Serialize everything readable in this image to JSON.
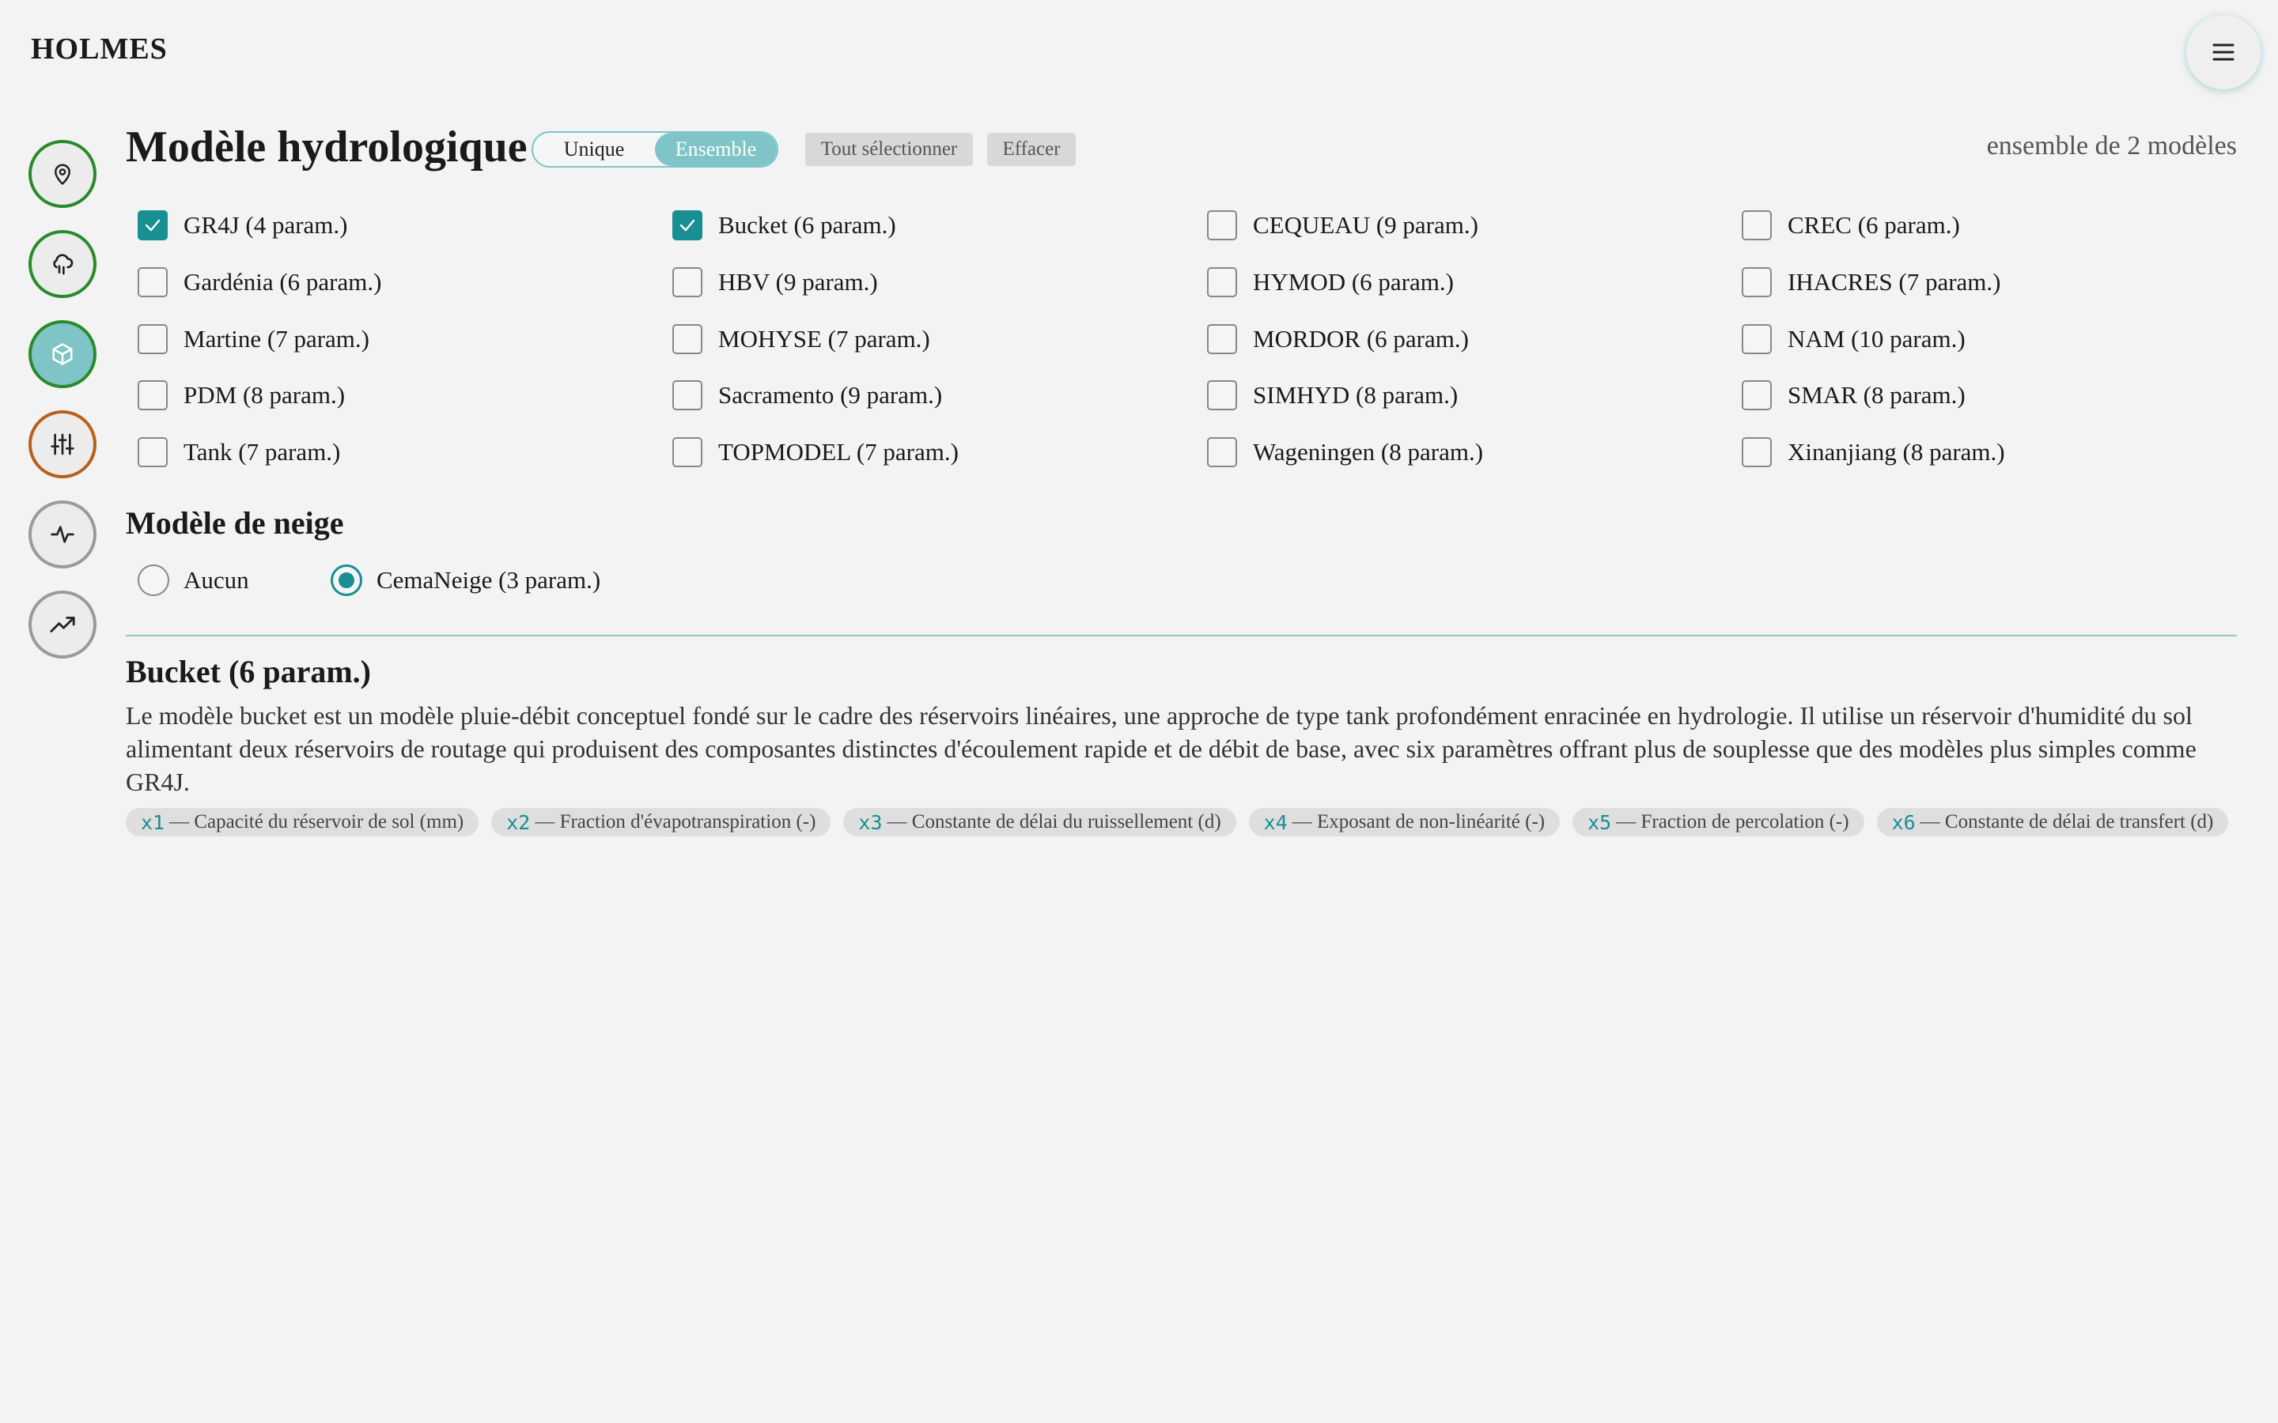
{
  "app": {
    "title": "HOLMES"
  },
  "header": {
    "menu_icon": "menu-icon"
  },
  "sidebar": {
    "items": [
      {
        "name": "location",
        "icon": "location-pin-icon"
      },
      {
        "name": "weather",
        "icon": "cloud-rain-icon"
      },
      {
        "name": "model",
        "icon": "cube-icon",
        "active": true
      },
      {
        "name": "calibration",
        "icon": "sliders-icon"
      },
      {
        "name": "simulation",
        "icon": "activity-icon"
      },
      {
        "name": "projection",
        "icon": "trending-up-icon"
      }
    ]
  },
  "hydro": {
    "title": "Modèle hydrologique",
    "mode_single": "Unique",
    "mode_ensemble": "Ensemble",
    "selected_mode": "Ensemble",
    "select_all": "Tout sélectionner",
    "clear": "Effacer",
    "ensemble_count": "ensemble de 2 modèles",
    "models": [
      {
        "label": "GR4J (4 param.)",
        "checked": true
      },
      {
        "label": "Bucket (6 param.)",
        "checked": true
      },
      {
        "label": "CEQUEAU (9 param.)",
        "checked": false
      },
      {
        "label": "CREC (6 param.)",
        "checked": false
      },
      {
        "label": "Gardénia (6 param.)",
        "checked": false
      },
      {
        "label": "HBV (9 param.)",
        "checked": false
      },
      {
        "label": "HYMOD (6 param.)",
        "checked": false
      },
      {
        "label": "IHACRES (7 param.)",
        "checked": false
      },
      {
        "label": "Martine (7 param.)",
        "checked": false
      },
      {
        "label": "MOHYSE (7 param.)",
        "checked": false
      },
      {
        "label": "MORDOR (6 param.)",
        "checked": false
      },
      {
        "label": "NAM (10 param.)",
        "checked": false
      },
      {
        "label": "PDM (8 param.)",
        "checked": false
      },
      {
        "label": "Sacramento (9 param.)",
        "checked": false
      },
      {
        "label": "SIMHYD (8 param.)",
        "checked": false
      },
      {
        "label": "SMAR (8 param.)",
        "checked": false
      },
      {
        "label": "Tank (7 param.)",
        "checked": false
      },
      {
        "label": "TOPMODEL (7 param.)",
        "checked": false
      },
      {
        "label": "Wageningen (8 param.)",
        "checked": false
      },
      {
        "label": "Xinanjiang (8 param.)",
        "checked": false
      }
    ]
  },
  "snow": {
    "title": "Modèle de neige",
    "options": [
      {
        "label": "Aucun",
        "selected": false
      },
      {
        "label": "CemaNeige (3 param.)",
        "selected": true
      }
    ]
  },
  "detail": {
    "title": "Bucket (6 param.)",
    "description": "Le modèle bucket est un modèle pluie-débit conceptuel fondé sur le cadre des réservoirs linéaires, une approche de type tank profondément enracinée en hydrologie. Il utilise un réservoir d'humidité du sol alimentant deux réservoirs de routage qui produisent des composantes distinctes d'écoulement rapide et de débit de base, avec six paramètres offrant plus de souplesse que des modèles plus simples comme GR4J.",
    "params": [
      {
        "key": "x1",
        "text": "— Capacité du réservoir de sol (mm)"
      },
      {
        "key": "x2",
        "text": "— Fraction d'évapotranspiration (-)"
      },
      {
        "key": "x3",
        "text": "— Constante de délai du ruissellement (d)"
      },
      {
        "key": "x4",
        "text": "— Exposant de non-linéarité (-)"
      },
      {
        "key": "x5",
        "text": "— Fraction de percolation (-)"
      },
      {
        "key": "x6",
        "text": "— Constante de délai de transfert (d)"
      }
    ]
  },
  "colors": {
    "accent": "#178f93",
    "accent_light": "#7fc4c6",
    "sidebar_green": "#2a8a2a",
    "sidebar_orange": "#b85f1a",
    "sidebar_gray": "#9a9a9a"
  }
}
